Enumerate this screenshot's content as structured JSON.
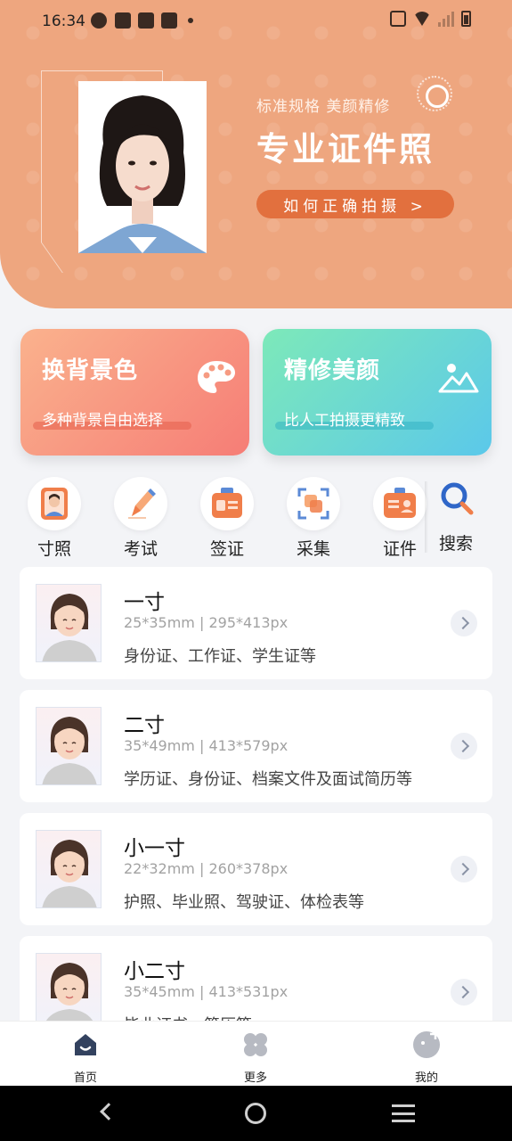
{
  "status_bar": {
    "time": "16:34",
    "icons": [
      "app-icon",
      "bag-icon",
      "bag-icon",
      "bag-icon",
      "dot-icon",
      "vibrate-icon",
      "wifi-icon",
      "signal-icon",
      "battery-icon"
    ]
  },
  "hero": {
    "subtitle": "标准规格 美颜精修",
    "title": "专业证件照",
    "button_label": "如何正确拍摄 >",
    "colors": {
      "background": "#eea67f",
      "button": "#e2703e"
    }
  },
  "features": [
    {
      "title": "换背景色",
      "subtitle": "多种背景自由选择",
      "icon": "palette-icon"
    },
    {
      "title": "精修美颜",
      "subtitle": "比人工拍摄更精致",
      "icon": "landscape-icon"
    }
  ],
  "categories": [
    {
      "label": "寸照",
      "icon": "portrait-icon"
    },
    {
      "label": "考试",
      "icon": "pen-icon"
    },
    {
      "label": "签证",
      "icon": "passport-icon"
    },
    {
      "label": "采集",
      "icon": "scan-icon"
    },
    {
      "label": "证件",
      "icon": "id-card-icon"
    }
  ],
  "search": {
    "label": "搜索"
  },
  "photo_sizes": [
    {
      "title": "一寸",
      "size": "25*35mm | 295*413px",
      "description": "身份证、工作证、学生证等"
    },
    {
      "title": "二寸",
      "size": "35*49mm | 413*579px",
      "description": "学历证、身份证、档案文件及面试简历等"
    },
    {
      "title": "小一寸",
      "size": "22*32mm | 260*378px",
      "description": "护照、毕业照、驾驶证、体检表等"
    },
    {
      "title": "小二寸",
      "size": "35*45mm | 413*531px",
      "description": "毕业证书、简历等"
    }
  ],
  "bottom_nav": [
    {
      "label": "首页",
      "icon": "home-icon"
    },
    {
      "label": "更多",
      "icon": "grid-icon"
    },
    {
      "label": "我的",
      "icon": "profile-icon"
    }
  ],
  "system_nav": [
    "back-icon",
    "home-circle-icon",
    "menu-icon"
  ]
}
